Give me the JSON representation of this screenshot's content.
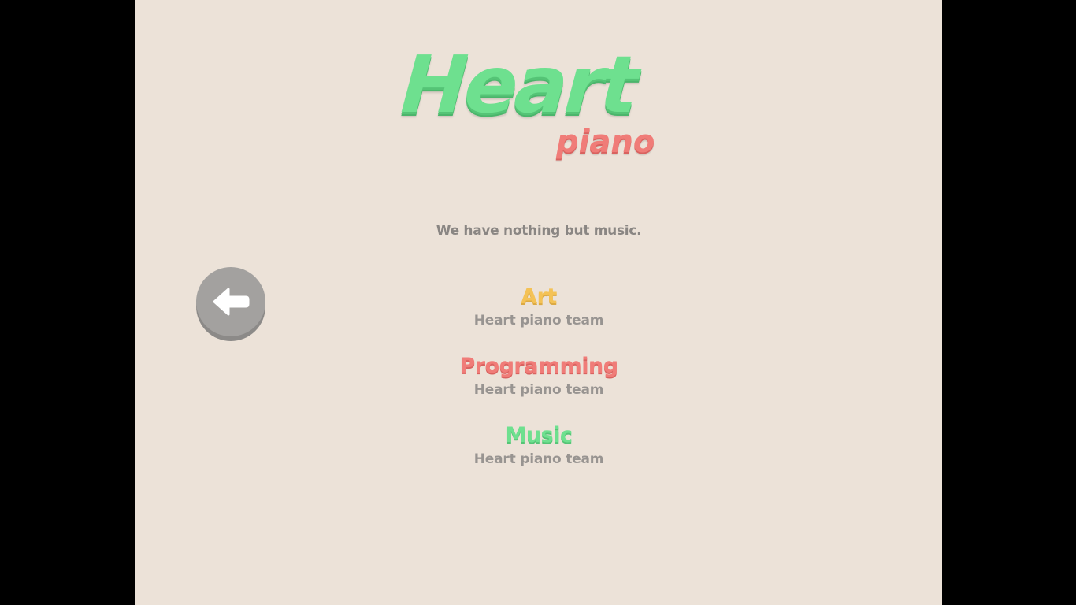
{
  "logo": {
    "title": "Heart",
    "subtitle": "piano"
  },
  "tagline": "We have nothing but music.",
  "back_button": {
    "icon": "arrow-left-icon"
  },
  "credits": [
    {
      "role": "Art",
      "name": "Heart piano team",
      "color": "#f4c256"
    },
    {
      "role": "Programming",
      "name": "Heart piano team",
      "color": "#f07c78"
    },
    {
      "role": "Music",
      "name": "Heart piano team",
      "color": "#6ee08f"
    }
  ],
  "colors": {
    "background": "#ece2d8",
    "logo_green": "#6ee08f",
    "logo_pink": "#f07c78",
    "button_gray": "#a3a19f"
  }
}
